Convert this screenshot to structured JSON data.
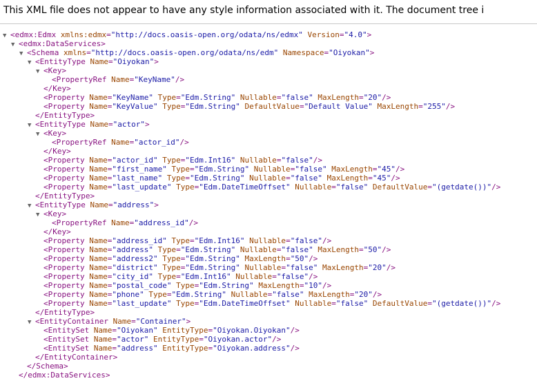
{
  "banner": {
    "text": "This XML file does not appear to have any style information associated with it. The document tree i"
  },
  "xml_lines": [
    {
      "indent": 0,
      "toggle": true,
      "tag": "<edmx:Edmx",
      "attrs": [
        [
          "xmlns:edmx",
          "\"http://docs.oasis-open.org/odata/ns/edmx\""
        ],
        [
          "Version",
          "\"4.0\""
        ]
      ],
      "close": ">"
    },
    {
      "indent": 1,
      "toggle": true,
      "tag": "<edmx:DataServices",
      "attrs": [],
      "close": ">"
    },
    {
      "indent": 2,
      "toggle": true,
      "tag": "<Schema",
      "attrs": [
        [
          "xmlns",
          "\"http://docs.oasis-open.org/odata/ns/edm\""
        ],
        [
          "Namespace",
          "\"Oiyokan\""
        ]
      ],
      "close": ">"
    },
    {
      "indent": 3,
      "toggle": true,
      "tag": "<EntityType",
      "attrs": [
        [
          "Name",
          "\"Oiyokan\""
        ]
      ],
      "close": ">"
    },
    {
      "indent": 4,
      "toggle": true,
      "tag": "<Key",
      "attrs": [],
      "close": ">"
    },
    {
      "indent": 5,
      "toggle": false,
      "tag": "<PropertyRef",
      "attrs": [
        [
          "Name",
          "\"KeyName\""
        ]
      ],
      "close": "/>"
    },
    {
      "indent": 4,
      "toggle": false,
      "tag": "</Key>",
      "attrs": [],
      "close": ""
    },
    {
      "indent": 4,
      "toggle": false,
      "tag": "<Property",
      "attrs": [
        [
          "Name",
          "\"KeyName\""
        ],
        [
          "Type",
          "\"Edm.String\""
        ],
        [
          "Nullable",
          "\"false\""
        ],
        [
          "MaxLength",
          "\"20\""
        ]
      ],
      "close": "/>"
    },
    {
      "indent": 4,
      "toggle": false,
      "tag": "<Property",
      "attrs": [
        [
          "Name",
          "\"KeyValue\""
        ],
        [
          "Type",
          "\"Edm.String\""
        ],
        [
          "DefaultValue",
          "\"Default Value\""
        ],
        [
          "MaxLength",
          "\"255\""
        ]
      ],
      "close": "/>"
    },
    {
      "indent": 3,
      "toggle": false,
      "tag": "</EntityType>",
      "attrs": [],
      "close": ""
    },
    {
      "indent": 3,
      "toggle": true,
      "tag": "<EntityType",
      "attrs": [
        [
          "Name",
          "\"actor\""
        ]
      ],
      "close": ">"
    },
    {
      "indent": 4,
      "toggle": true,
      "tag": "<Key",
      "attrs": [],
      "close": ">"
    },
    {
      "indent": 5,
      "toggle": false,
      "tag": "<PropertyRef",
      "attrs": [
        [
          "Name",
          "\"actor_id\""
        ]
      ],
      "close": "/>"
    },
    {
      "indent": 4,
      "toggle": false,
      "tag": "</Key>",
      "attrs": [],
      "close": ""
    },
    {
      "indent": 4,
      "toggle": false,
      "tag": "<Property",
      "attrs": [
        [
          "Name",
          "\"actor_id\""
        ],
        [
          "Type",
          "\"Edm.Int16\""
        ],
        [
          "Nullable",
          "\"false\""
        ]
      ],
      "close": "/>"
    },
    {
      "indent": 4,
      "toggle": false,
      "tag": "<Property",
      "attrs": [
        [
          "Name",
          "\"first_name\""
        ],
        [
          "Type",
          "\"Edm.String\""
        ],
        [
          "Nullable",
          "\"false\""
        ],
        [
          "MaxLength",
          "\"45\""
        ]
      ],
      "close": "/>"
    },
    {
      "indent": 4,
      "toggle": false,
      "tag": "<Property",
      "attrs": [
        [
          "Name",
          "\"last_name\""
        ],
        [
          "Type",
          "\"Edm.String\""
        ],
        [
          "Nullable",
          "\"false\""
        ],
        [
          "MaxLength",
          "\"45\""
        ]
      ],
      "close": "/>"
    },
    {
      "indent": 4,
      "toggle": false,
      "tag": "<Property",
      "attrs": [
        [
          "Name",
          "\"last_update\""
        ],
        [
          "Type",
          "\"Edm.DateTimeOffset\""
        ],
        [
          "Nullable",
          "\"false\""
        ],
        [
          "DefaultValue",
          "\"(getdate())\""
        ]
      ],
      "close": "/>"
    },
    {
      "indent": 3,
      "toggle": false,
      "tag": "</EntityType>",
      "attrs": [],
      "close": ""
    },
    {
      "indent": 3,
      "toggle": true,
      "tag": "<EntityType",
      "attrs": [
        [
          "Name",
          "\"address\""
        ]
      ],
      "close": ">"
    },
    {
      "indent": 4,
      "toggle": true,
      "tag": "<Key",
      "attrs": [],
      "close": ">"
    },
    {
      "indent": 5,
      "toggle": false,
      "tag": "<PropertyRef",
      "attrs": [
        [
          "Name",
          "\"address_id\""
        ]
      ],
      "close": "/>"
    },
    {
      "indent": 4,
      "toggle": false,
      "tag": "</Key>",
      "attrs": [],
      "close": ""
    },
    {
      "indent": 4,
      "toggle": false,
      "tag": "<Property",
      "attrs": [
        [
          "Name",
          "\"address_id\""
        ],
        [
          "Type",
          "\"Edm.Int16\""
        ],
        [
          "Nullable",
          "\"false\""
        ]
      ],
      "close": "/>"
    },
    {
      "indent": 4,
      "toggle": false,
      "tag": "<Property",
      "attrs": [
        [
          "Name",
          "\"address\""
        ],
        [
          "Type",
          "\"Edm.String\""
        ],
        [
          "Nullable",
          "\"false\""
        ],
        [
          "MaxLength",
          "\"50\""
        ]
      ],
      "close": "/>"
    },
    {
      "indent": 4,
      "toggle": false,
      "tag": "<Property",
      "attrs": [
        [
          "Name",
          "\"address2\""
        ],
        [
          "Type",
          "\"Edm.String\""
        ],
        [
          "MaxLength",
          "\"50\""
        ]
      ],
      "close": "/>"
    },
    {
      "indent": 4,
      "toggle": false,
      "tag": "<Property",
      "attrs": [
        [
          "Name",
          "\"district\""
        ],
        [
          "Type",
          "\"Edm.String\""
        ],
        [
          "Nullable",
          "\"false\""
        ],
        [
          "MaxLength",
          "\"20\""
        ]
      ],
      "close": "/>"
    },
    {
      "indent": 4,
      "toggle": false,
      "tag": "<Property",
      "attrs": [
        [
          "Name",
          "\"city_id\""
        ],
        [
          "Type",
          "\"Edm.Int16\""
        ],
        [
          "Nullable",
          "\"false\""
        ]
      ],
      "close": "/>"
    },
    {
      "indent": 4,
      "toggle": false,
      "tag": "<Property",
      "attrs": [
        [
          "Name",
          "\"postal_code\""
        ],
        [
          "Type",
          "\"Edm.String\""
        ],
        [
          "MaxLength",
          "\"10\""
        ]
      ],
      "close": "/>"
    },
    {
      "indent": 4,
      "toggle": false,
      "tag": "<Property",
      "attrs": [
        [
          "Name",
          "\"phone\""
        ],
        [
          "Type",
          "\"Edm.String\""
        ],
        [
          "Nullable",
          "\"false\""
        ],
        [
          "MaxLength",
          "\"20\""
        ]
      ],
      "close": "/>"
    },
    {
      "indent": 4,
      "toggle": false,
      "tag": "<Property",
      "attrs": [
        [
          "Name",
          "\"last_update\""
        ],
        [
          "Type",
          "\"Edm.DateTimeOffset\""
        ],
        [
          "Nullable",
          "\"false\""
        ],
        [
          "DefaultValue",
          "\"(getdate())\""
        ]
      ],
      "close": "/>"
    },
    {
      "indent": 3,
      "toggle": false,
      "tag": "</EntityType>",
      "attrs": [],
      "close": ""
    },
    {
      "indent": 3,
      "toggle": true,
      "tag": "<EntityContainer",
      "attrs": [
        [
          "Name",
          "\"Container\""
        ]
      ],
      "close": ">"
    },
    {
      "indent": 4,
      "toggle": false,
      "tag": "<EntitySet",
      "attrs": [
        [
          "Name",
          "\"Oiyokan\""
        ],
        [
          "EntityType",
          "\"Oiyokan.Oiyokan\""
        ]
      ],
      "close": "/>"
    },
    {
      "indent": 4,
      "toggle": false,
      "tag": "<EntitySet",
      "attrs": [
        [
          "Name",
          "\"actor\""
        ],
        [
          "EntityType",
          "\"Oiyokan.actor\""
        ]
      ],
      "close": "/>"
    },
    {
      "indent": 4,
      "toggle": false,
      "tag": "<EntitySet",
      "attrs": [
        [
          "Name",
          "\"address\""
        ],
        [
          "EntityType",
          "\"Oiyokan.address\""
        ]
      ],
      "close": "/>"
    },
    {
      "indent": 3,
      "toggle": false,
      "tag": "</EntityContainer>",
      "attrs": [],
      "close": ""
    },
    {
      "indent": 2,
      "toggle": false,
      "tag": "</Schema>",
      "attrs": [],
      "close": ""
    },
    {
      "indent": 1,
      "toggle": false,
      "tag": "</edmx:DataServices>",
      "attrs": [],
      "close": ""
    }
  ]
}
